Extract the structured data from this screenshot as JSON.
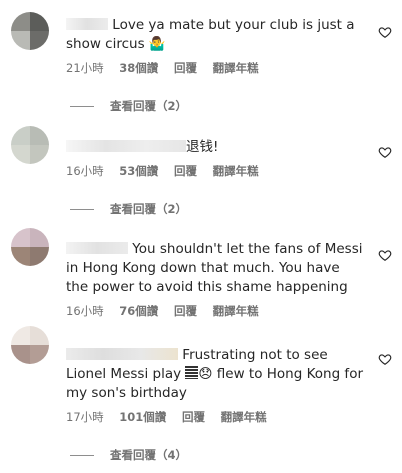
{
  "comments": [
    {
      "text_part1": "Love ya mate but your club is just a show circus",
      "emoji": "🤷‍♂️",
      "time": "21小時",
      "likes": "38個讚",
      "reply": "回覆",
      "translate": "翻譯年糕",
      "view_replies": "查看回覆（2）"
    },
    {
      "text_part1": "退钱!",
      "time": "16小時",
      "likes": "53個讚",
      "reply": "回覆",
      "translate": "翻譯年糕",
      "view_replies": "查看回覆（2）"
    },
    {
      "text_part1": "You shouldn't let the fans of Messi in Hong Kong down that much. You have the power to avoid this shame happening",
      "time": "16小時",
      "likes": "76個讚",
      "reply": "回覆",
      "translate": "翻譯年糕"
    },
    {
      "text_part1": "Frustrating not to see Lionel Messi play",
      "emoji": "😞",
      "text_part2": "flew to Hong Kong for my son's birthday",
      "time": "17小時",
      "likes": "101個讚",
      "reply": "回覆",
      "translate": "翻譯年糕",
      "view_replies": "查看回覆（4）"
    }
  ],
  "icons": {
    "like": "heart-outline-icon"
  },
  "colors": {
    "text": "#262626",
    "meta": "#737373"
  }
}
